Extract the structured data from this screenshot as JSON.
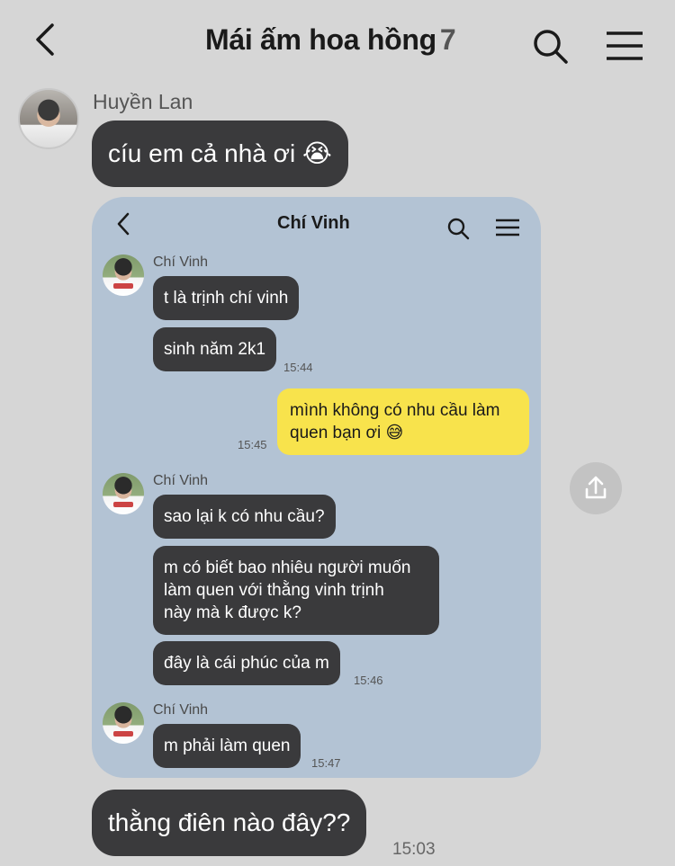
{
  "header": {
    "title": "Mái ấm hoa hồng",
    "member_count": "7",
    "back_icon": "chevron-left-icon",
    "search_icon": "search-icon",
    "menu_icon": "hamburger-menu-icon"
  },
  "chat": {
    "messages": [
      {
        "sender": "Huyền Lan",
        "text": "cíu em cả nhà ơi 😭"
      },
      {
        "text": "thằng điên nào đây??",
        "time": "15:03"
      }
    ]
  },
  "screenshot": {
    "header": {
      "title": "Chí Vinh"
    },
    "groups": [
      {
        "sender": "Chí Vinh",
        "messages": [
          {
            "text": "t là trịnh chí vinh"
          },
          {
            "text": "sinh năm 2k1",
            "time": "15:44"
          }
        ]
      },
      {
        "sent": true,
        "lines": [
          "mình không có nhu cầu làm",
          "quen bạn ơi 😅"
        ],
        "time": "15:45"
      },
      {
        "sender": "Chí Vinh",
        "messages": [
          {
            "text": "sao lại k có nhu cầu?"
          },
          {
            "lines": [
              "m có biết bao nhiêu người muốn",
              "làm quen với thằng vinh trịnh",
              "này mà k được k?"
            ]
          },
          {
            "text": "đây là cái phúc của m",
            "time": "15:46"
          }
        ]
      },
      {
        "sender": "Chí Vinh",
        "messages": [
          {
            "text": "m phải làm quen",
            "time": "15:47"
          }
        ]
      }
    ]
  },
  "share_icon": "share-upload-icon",
  "colors": {
    "background": "#d6d6d6",
    "bubble_dark": "#3a3a3c",
    "bubble_sent": "#f8e34c",
    "screenshot_bg": "#b3c3d4"
  }
}
